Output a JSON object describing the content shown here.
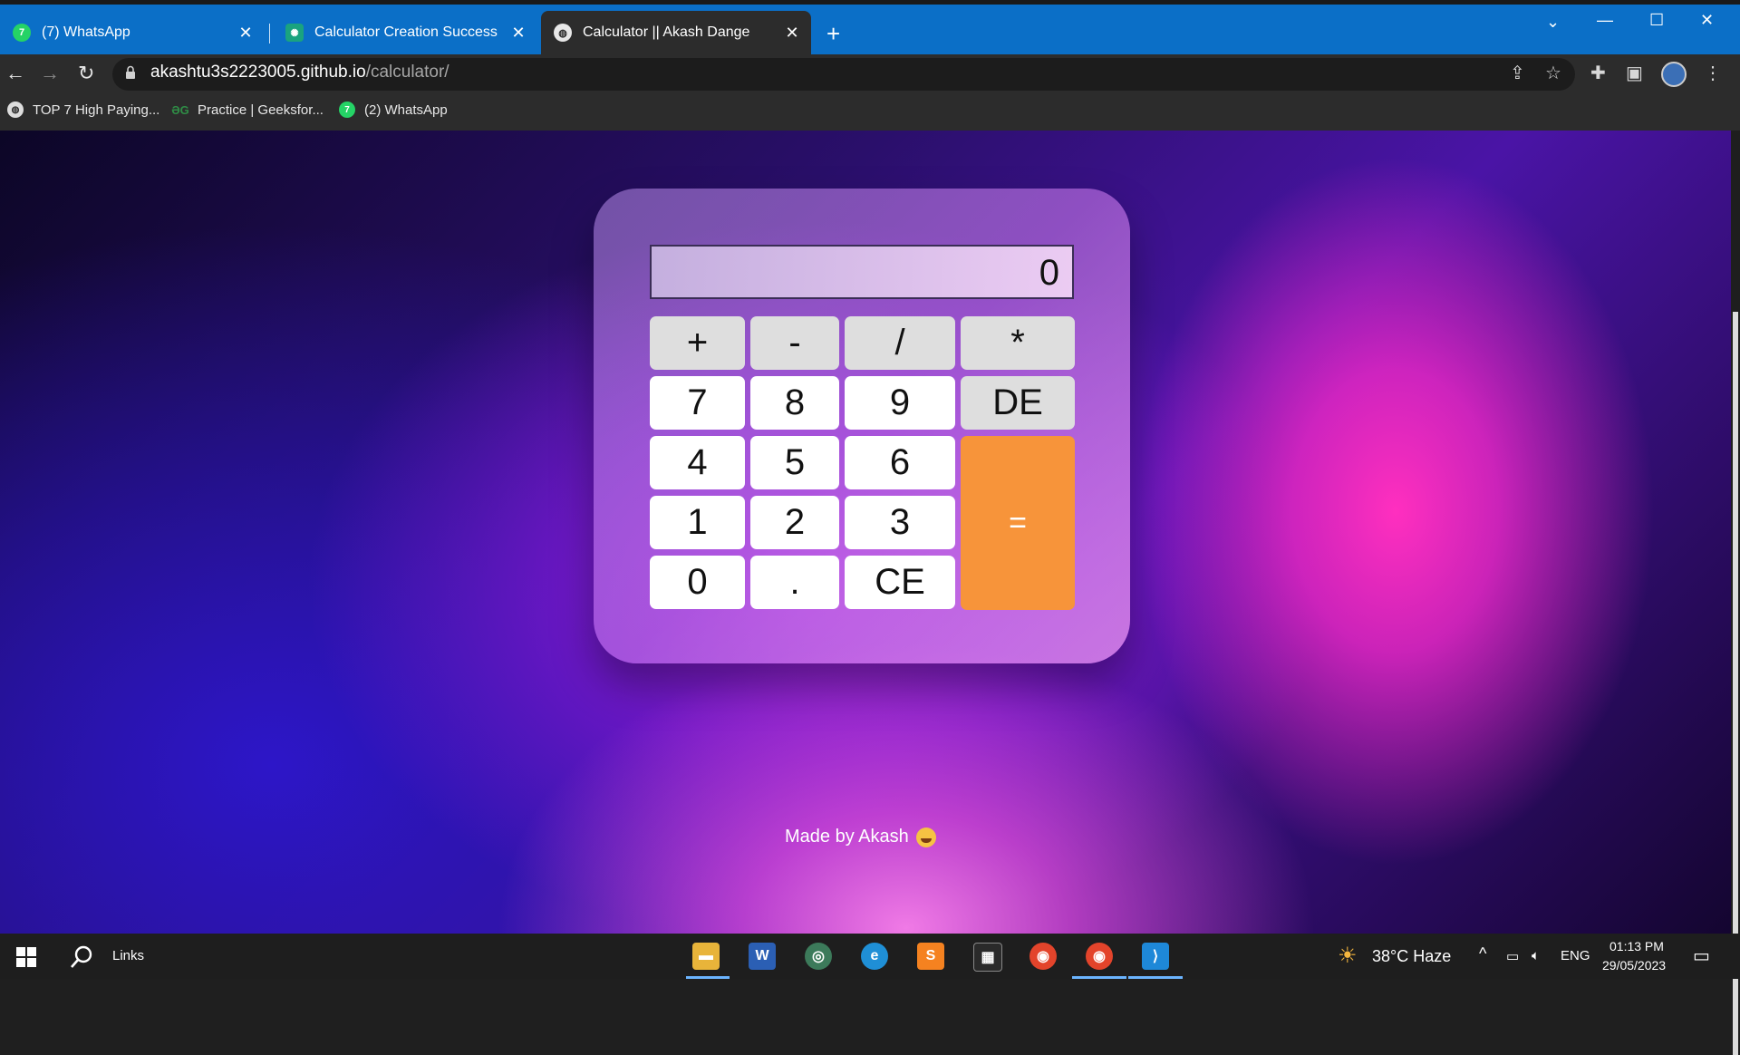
{
  "browser": {
    "tabs": [
      {
        "title": "(7) WhatsApp",
        "icon": "whatsapp-icon"
      },
      {
        "title": "Calculator Creation Success",
        "icon": "chatgpt-icon"
      },
      {
        "title": "Calculator || Akash Dange",
        "icon": "globe-icon",
        "active": true
      }
    ],
    "new_tab": "+",
    "url_host": "akashtu3s2223005.github.io",
    "url_path": "/calculator/",
    "bookmarks": [
      {
        "label": "TOP 7 High Paying...",
        "icon": "globe-icon"
      },
      {
        "label": "Practice | Geeksfor...",
        "icon": "geeksforgeeks-icon"
      },
      {
        "label": "(2) WhatsApp",
        "icon": "whatsapp-icon"
      }
    ],
    "whatsapp_badge_7": "7",
    "whatsapp_badge_2": "7"
  },
  "calculator": {
    "display": "0",
    "keys": {
      "plus": "+",
      "minus": "-",
      "divide": "/",
      "multiply": "*",
      "seven": "7",
      "eight": "8",
      "nine": "9",
      "de": "DE",
      "four": "4",
      "five": "5",
      "six": "6",
      "equals": "=",
      "one": "1",
      "two": "2",
      "three": "3",
      "zero": "0",
      "dot": ".",
      "ce": "CE"
    }
  },
  "footer": {
    "credit": "Made by Akash"
  },
  "taskbar": {
    "search_label": "Links",
    "weather": "38°C  Haze",
    "language": "ENG",
    "time": "01:13 PM",
    "date": "29/05/2023"
  },
  "colors": {
    "accent": "#f7943a",
    "tabbar": "#0b6fc7"
  }
}
